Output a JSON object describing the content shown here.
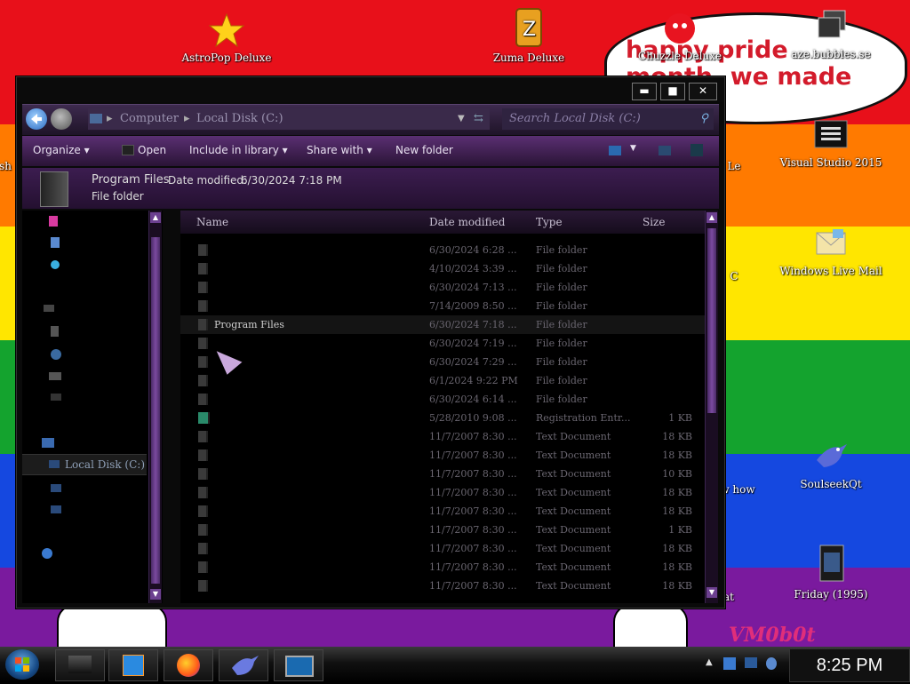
{
  "desktop": {
    "speech_bubble_text": "happy pride month. we made it here!",
    "partial_labels": {
      "left_edge": "sh",
      "mid_right": "Le",
      "reg_c": "C",
      "show_how": "w how",
      "friday_left": "at"
    },
    "watermark": "VM0b0t",
    "icons": [
      {
        "label": "AstroPop Deluxe",
        "icon": "astropop-icon"
      },
      {
        "label": "Zuma Deluxe",
        "icon": "zuma-icon"
      },
      {
        "label": "Chuzzle Deluxe",
        "icon": "chuzzle-icon"
      },
      {
        "label": "aze.bubbles.se",
        "icon": "windows-stack-icon"
      },
      {
        "label": "Visual Studio 2015",
        "icon": "visual-studio-icon"
      },
      {
        "label": "Windows Live Mail",
        "icon": "mail-icon"
      },
      {
        "label": "SoulseekQt",
        "icon": "soulseek-bird-icon"
      },
      {
        "label": "Friday (1995)",
        "icon": "video-file-icon"
      }
    ]
  },
  "window": {
    "controls": {
      "minimize": "▬",
      "maximize": "■",
      "close": "✕"
    },
    "address": {
      "breadcrumb": [
        "Computer",
        "Local Disk (C:)"
      ],
      "search_placeholder": "Search Local Disk (C:)"
    },
    "toolbar": {
      "organize": "Organize ▾",
      "open": "Open",
      "include": "Include in library ▾",
      "share": "Share with ▾",
      "new_folder": "New folder"
    },
    "details": {
      "name": "Program Files",
      "date_label": "Date modified:",
      "date_value": "6/30/2024 7:18 PM",
      "type": "File folder"
    },
    "navpane": {
      "selected_item": "Local Disk (C:)"
    },
    "columns": {
      "name": "Name",
      "date": "Date modified",
      "type": "Type",
      "size": "Size"
    },
    "rows": [
      {
        "name": "",
        "date": "6/30/2024 6:28 ...",
        "type": "File folder",
        "size": ""
      },
      {
        "name": "",
        "date": "4/10/2024 3:39 ...",
        "type": "File folder",
        "size": ""
      },
      {
        "name": "",
        "date": "6/30/2024 7:13 ...",
        "type": "File folder",
        "size": ""
      },
      {
        "name": "",
        "date": "7/14/2009 8:50 ...",
        "type": "File folder",
        "size": ""
      },
      {
        "name": "Program Files",
        "date": "6/30/2024 7:18 ...",
        "type": "File folder",
        "size": ""
      },
      {
        "name": "",
        "date": "6/30/2024 7:19 ...",
        "type": "File folder",
        "size": ""
      },
      {
        "name": "",
        "date": "6/30/2024 7:29 ...",
        "type": "File folder",
        "size": ""
      },
      {
        "name": "",
        "date": "6/1/2024 9:22 PM",
        "type": "File folder",
        "size": ""
      },
      {
        "name": "",
        "date": "6/30/2024 6:14 ...",
        "type": "File folder",
        "size": ""
      },
      {
        "name": "",
        "date": "5/28/2010 9:08 ...",
        "type": "Registration Entr...",
        "size": "1 KB"
      },
      {
        "name": "",
        "date": "11/7/2007 8:30 ...",
        "type": "Text Document",
        "size": "18 KB"
      },
      {
        "name": "",
        "date": "11/7/2007 8:30 ...",
        "type": "Text Document",
        "size": "18 KB"
      },
      {
        "name": "",
        "date": "11/7/2007 8:30 ...",
        "type": "Text Document",
        "size": "10 KB"
      },
      {
        "name": "",
        "date": "11/7/2007 8:30 ...",
        "type": "Text Document",
        "size": "18 KB"
      },
      {
        "name": "",
        "date": "11/7/2007 8:30 ...",
        "type": "Text Document",
        "size": "18 KB"
      },
      {
        "name": "",
        "date": "11/7/2007 8:30 ...",
        "type": "Text Document",
        "size": "1 KB"
      },
      {
        "name": "",
        "date": "11/7/2007 8:30 ...",
        "type": "Text Document",
        "size": "18 KB"
      },
      {
        "name": "",
        "date": "11/7/2007 8:30 ...",
        "type": "Text Document",
        "size": "18 KB"
      },
      {
        "name": "",
        "date": "11/7/2007 8:30 ...",
        "type": "Text Document",
        "size": "18 KB"
      }
    ]
  },
  "taskbar": {
    "clock": "8:25 PM",
    "pinned": [
      "file-explorer-icon",
      "media-player-icon",
      "firefox-icon",
      "soulseek-bird-icon",
      "monitor-icon"
    ]
  },
  "colors": {
    "red": "#e8101a",
    "orange": "#ff7a00",
    "yellow": "#ffe600",
    "green": "#14a32e",
    "blue": "#1548e0",
    "purple": "#7a1a9e",
    "accent_purple": "#5a2f72",
    "bubble_text": "#d31b2b"
  }
}
